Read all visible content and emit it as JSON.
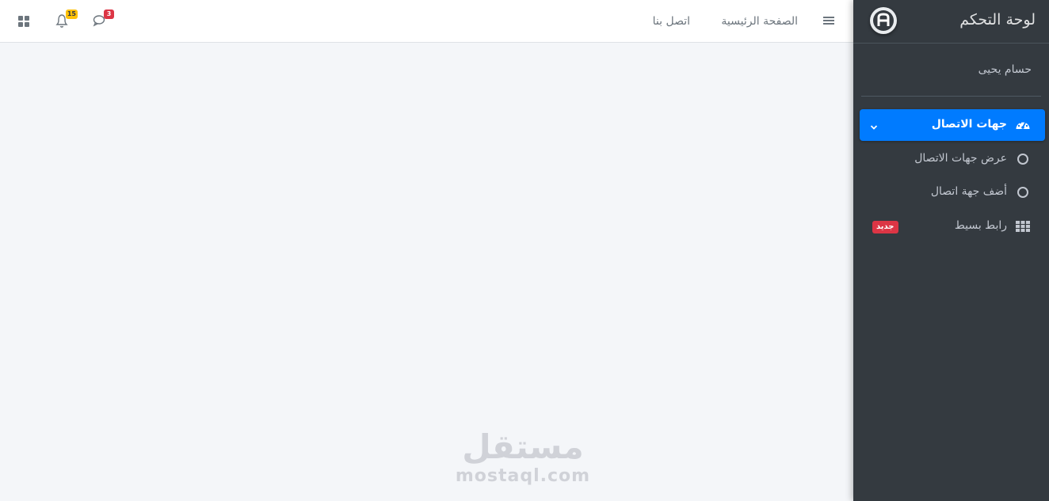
{
  "sidebar": {
    "brand_title": "لوحة التحكم",
    "user_name": "حسام يحيى",
    "menu": {
      "contacts": "جهات الاتصال",
      "view_contacts": "عرض جهات الاتصال",
      "add_contact": "أضف جهة اتصال",
      "simple_link": "رابط بسيط",
      "new_badge": "جديد"
    }
  },
  "navbar": {
    "home": "الصفحة الرئيسية",
    "contact_us": "اتصل بنا",
    "messages_count": "3",
    "notifications_count": "15"
  },
  "watermark": {
    "arabic": "مستقل",
    "latin": "mostaql.com"
  },
  "colors": {
    "sidebar_bg": "#343a40",
    "active_bg": "#007bff",
    "danger": "#dc3545",
    "warning": "#ffc107"
  }
}
